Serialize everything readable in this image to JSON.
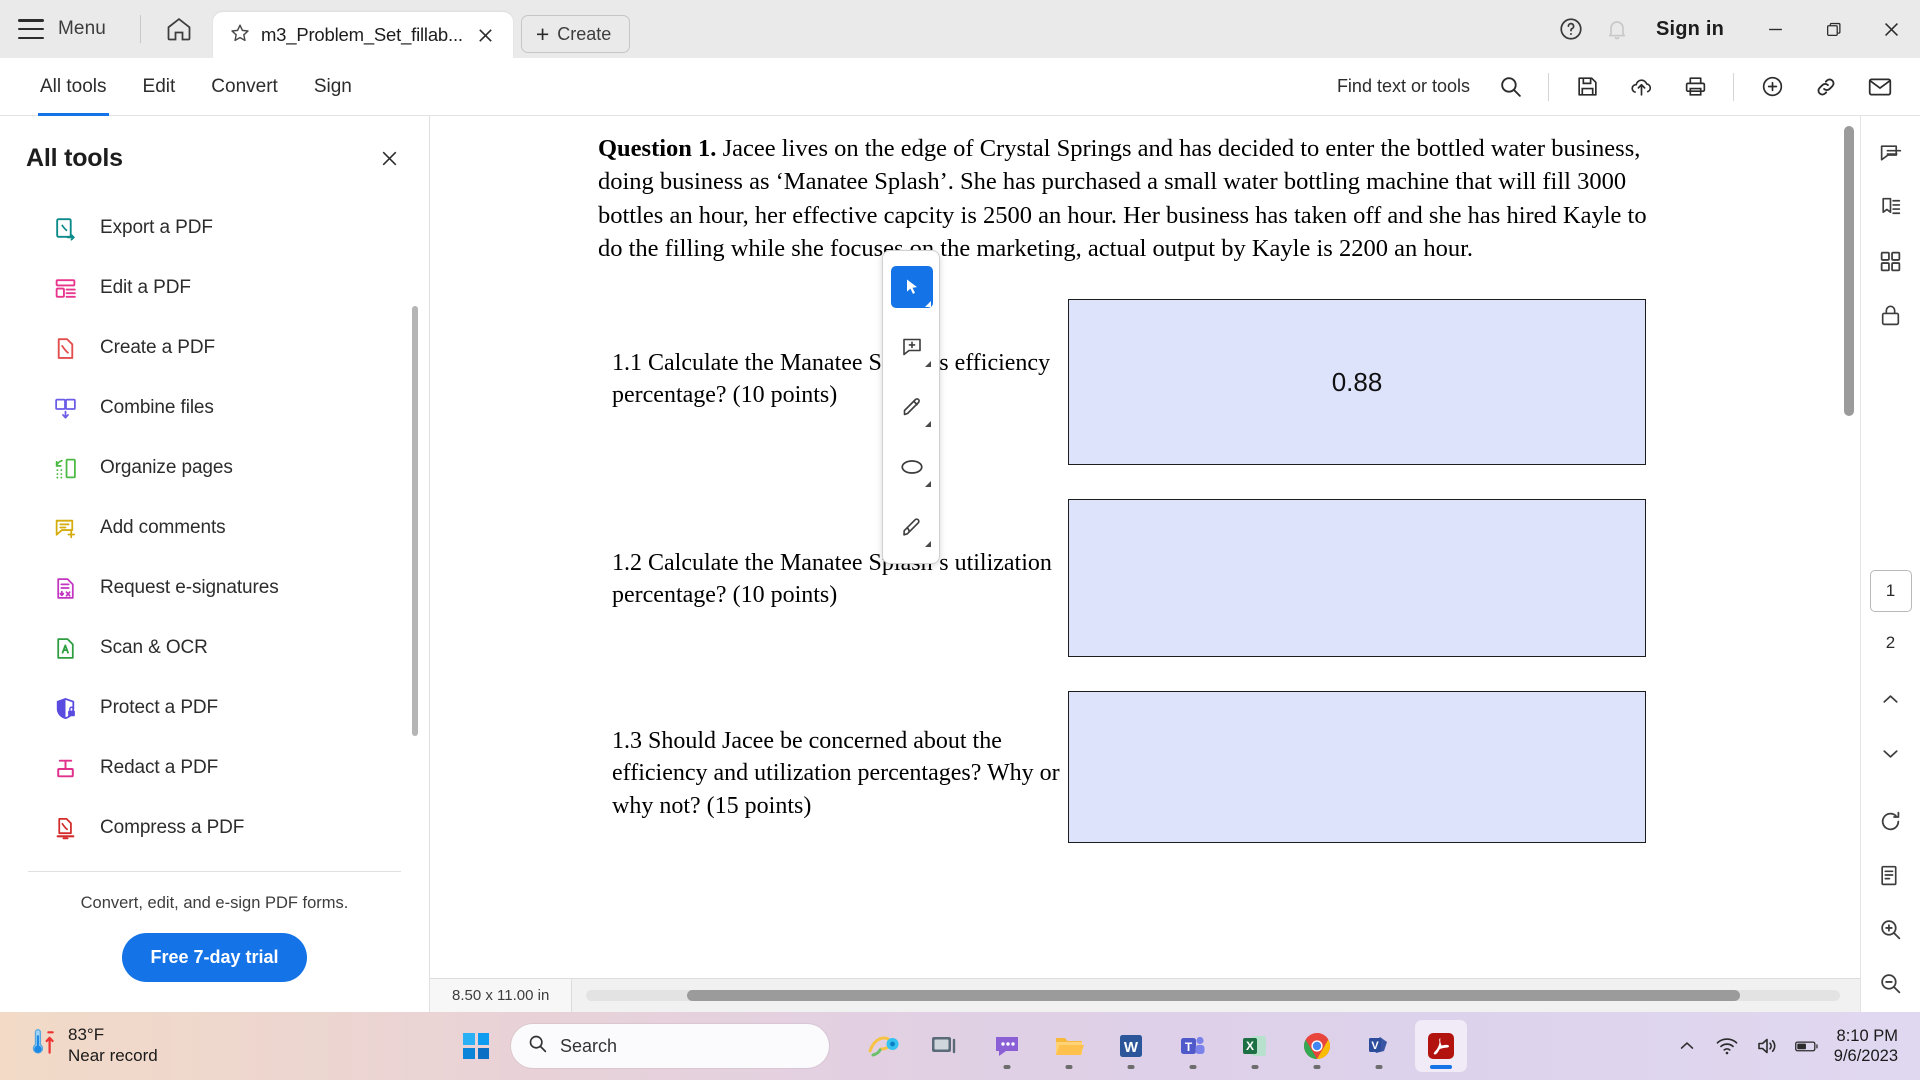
{
  "titlebar": {
    "menu_label": "Menu",
    "home_icon": "home-icon",
    "tab": {
      "title": "m3_Problem_Set_fillab...",
      "star_icon": "star-icon",
      "close_icon": "close-icon"
    },
    "create_label": "Create",
    "help_icon": "help-circle-icon",
    "bell_icon": "notification-bell-icon",
    "signin_label": "Sign in",
    "minimize": "minimize-icon",
    "maximize": "restore-icon",
    "close": "window-close-icon"
  },
  "toolbar": {
    "tabs": [
      {
        "label": "All tools",
        "active": true
      },
      {
        "label": "Edit",
        "active": false
      },
      {
        "label": "Convert",
        "active": false
      },
      {
        "label": "Sign",
        "active": false
      }
    ],
    "find_label": "Find text or tools",
    "icons": [
      "search-icon",
      "save-icon",
      "upload-cloud-icon",
      "print-icon",
      "add-stamp-icon",
      "share-link-icon",
      "email-icon"
    ]
  },
  "sidebar": {
    "title": "All tools",
    "close_icon": "close-icon",
    "items": [
      {
        "label": "Export a PDF",
        "icon": "export-pdf-icon",
        "color": "#0d8a8a"
      },
      {
        "label": "Edit a PDF",
        "icon": "edit-pdf-icon",
        "color": "#e8368f"
      },
      {
        "label": "Create a PDF",
        "icon": "create-pdf-icon",
        "color": "#e34f4f"
      },
      {
        "label": "Combine files",
        "icon": "combine-files-icon",
        "color": "#6c5ce7"
      },
      {
        "label": "Organize pages",
        "icon": "organize-pages-icon",
        "color": "#4cb944"
      },
      {
        "label": "Add comments",
        "icon": "add-comments-icon",
        "color": "#d4ac0d"
      },
      {
        "label": "Request e-signatures",
        "icon": "request-esign-icon",
        "color": "#c236c2"
      },
      {
        "label": "Scan & OCR",
        "icon": "scan-ocr-icon",
        "color": "#2e9e40"
      },
      {
        "label": "Protect a PDF",
        "icon": "protect-pdf-icon",
        "color": "#5a4be0"
      },
      {
        "label": "Redact a PDF",
        "icon": "redact-pdf-icon",
        "color": "#e0318c"
      },
      {
        "label": "Compress a PDF",
        "icon": "compress-pdf-icon",
        "color": "#d42b2b"
      }
    ],
    "footer_text": "Convert, edit, and e-sign PDF forms.",
    "trial_button": "Free 7-day trial"
  },
  "annotation_toolbar": {
    "tools": [
      {
        "name": "select-tool",
        "selected": true
      },
      {
        "name": "add-comment-tool",
        "selected": false
      },
      {
        "name": "highlight-tool",
        "selected": false
      },
      {
        "name": "draw-oval-tool",
        "selected": false
      },
      {
        "name": "draw-freehand-tool",
        "selected": false
      }
    ]
  },
  "document": {
    "question_label": "Question 1.",
    "question_body": "Jacee lives on the edge of  Crystal Springs and has decided to enter the bottled water business, doing business as ‘Manatee Splash’.  She has purchased a small water bottling machine that will fill 3000 bottles an hour, her effective capcity is 2500 an hour.  Her business has taken off and she has hired Kayle to do the filling while she focuses on the marketing, actual output by Kayle is 2200 an hour.",
    "items": [
      {
        "prompt": "1.1 Calculate the Manatee Splash’s efficiency percentage? (10 points)",
        "value": "0.88"
      },
      {
        "prompt": "1.2 Calculate the Manatee Splash’s utilization percentage? (10 points)",
        "value": ""
      },
      {
        "prompt": "1.3 Should Jacee be concerned about the efficiency and utilization percentages? Why or why not? (15 points)",
        "value": ""
      }
    ]
  },
  "statusbar": {
    "page_size": "8.50 x 11.00 in"
  },
  "rightrail": {
    "icons_top": [
      "comment-panel-icon",
      "bookmark-panel-icon",
      "thumbnails-panel-icon",
      "lock-panel-icon"
    ],
    "page_current": "1",
    "page_next": "2",
    "nav_up": "chevron-up-icon",
    "nav_down": "chevron-down-icon",
    "icons_bottom": [
      "rotate-icon",
      "page-fit-icon",
      "zoom-in-icon",
      "zoom-out-icon"
    ]
  },
  "taskbar": {
    "weather": {
      "temp": "83°F",
      "desc": "Near record",
      "icon": "thermometer-icon"
    },
    "start_icon": "windows-start-icon",
    "search_placeholder": "Search",
    "search_icon": "search-icon",
    "apps": [
      {
        "name": "copilot-icon",
        "active": false
      },
      {
        "name": "task-view-icon",
        "active": false
      },
      {
        "name": "chat-teams-icon",
        "active": false
      },
      {
        "name": "file-explorer-icon",
        "active": false
      },
      {
        "name": "word-icon",
        "active": false
      },
      {
        "name": "teams-icon",
        "active": false
      },
      {
        "name": "excel-icon",
        "active": false
      },
      {
        "name": "chrome-icon",
        "active": false
      },
      {
        "name": "visio-icon",
        "active": false
      },
      {
        "name": "acrobat-icon",
        "active": true
      }
    ],
    "tray": [
      "chevron-up-icon",
      "wifi-icon",
      "volume-icon",
      "battery-icon"
    ],
    "clock": {
      "time": "8:10 PM",
      "date": "9/6/2023"
    }
  }
}
